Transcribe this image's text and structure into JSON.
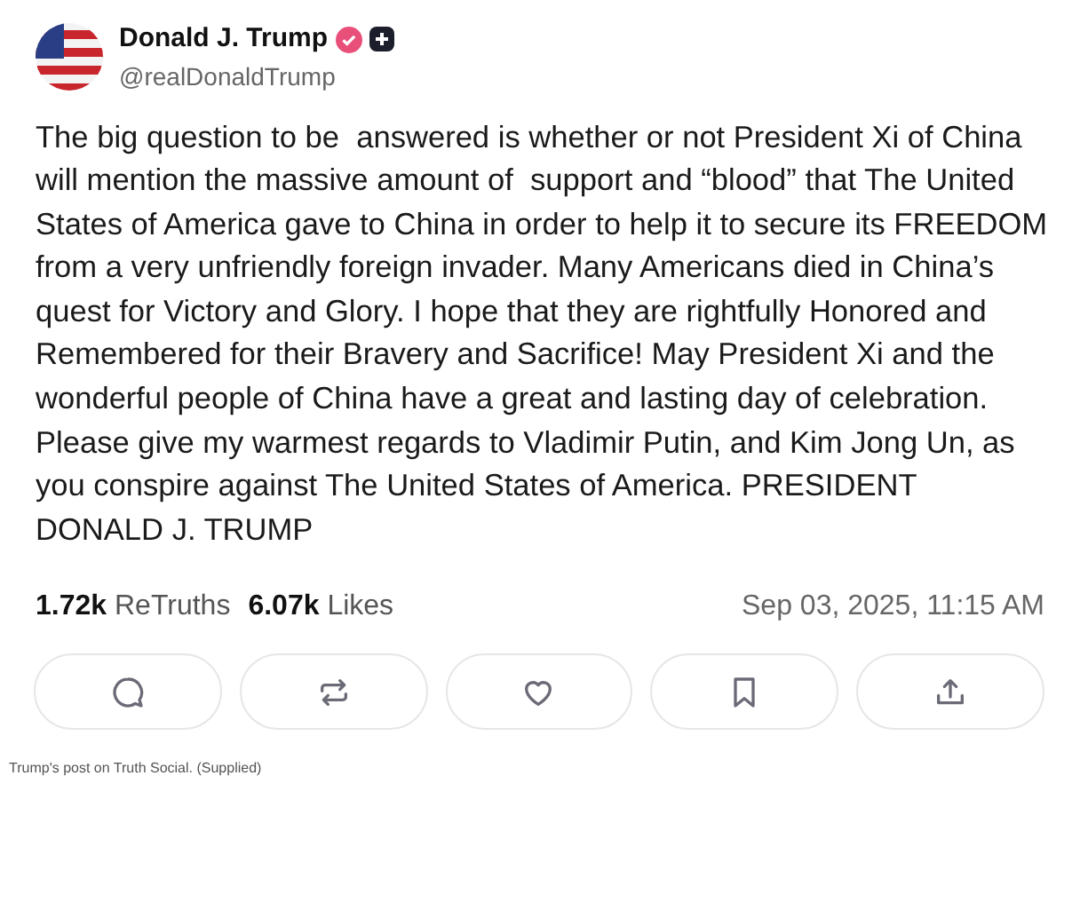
{
  "post": {
    "author": "Donald J. Trump",
    "handle": "@realDonaldTrump",
    "verified": true,
    "text": "The big question to be  answered is whether or not President Xi of China will mention the massive amount of  support and “blood” that The United States of America gave to China in order to help it to secure its FREEDOM from a very unfriendly foreign invader. Many Americans died in China’s quest for Victory and Glory. I hope that they are rightfully Honored and Remembered for their Bravery and Sacrifice! May President Xi and the wonderful people of China have a great and lasting day of celebration. Please give my warmest regards to Vladimir Putin, and Kim Jong Un, as you conspire against The United States of America. PRESIDENT DONALD J. TRUMP",
    "stats": [
      {
        "count": "1.72k",
        "label": "ReTruths"
      },
      {
        "count": "6.07k",
        "label": "Likes"
      }
    ],
    "timestamp": "Sep 03, 2025, 11:15 AM",
    "actions": [
      {
        "kind": "reply"
      },
      {
        "kind": "repost"
      },
      {
        "kind": "like"
      },
      {
        "kind": "bookmark"
      },
      {
        "kind": "share"
      }
    ]
  },
  "caption": "Trump's post on Truth Social. (Supplied)"
}
